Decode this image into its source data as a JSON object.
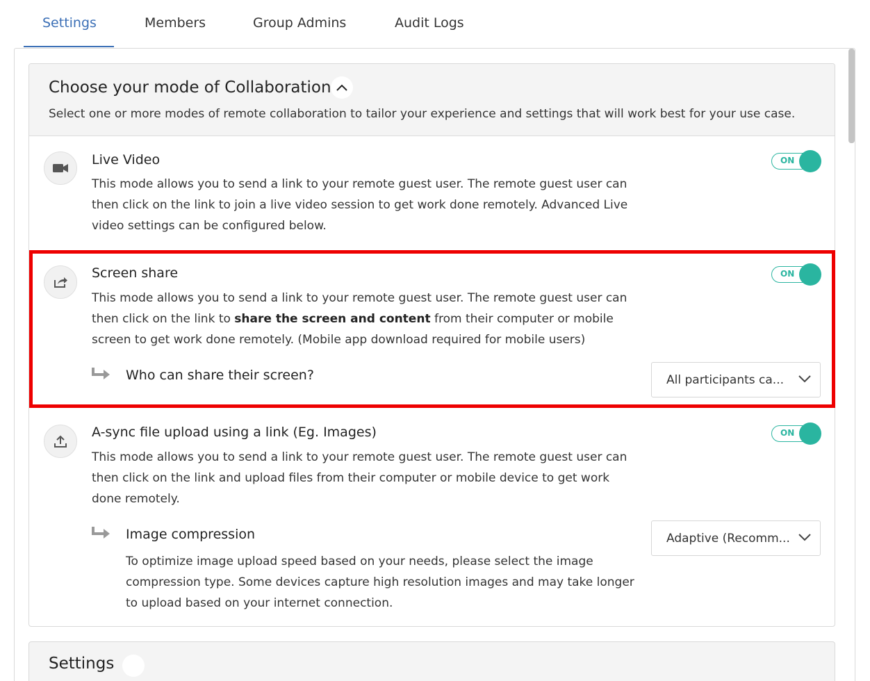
{
  "tabs": [
    {
      "label": "Settings",
      "active": true
    },
    {
      "label": "Members",
      "active": false
    },
    {
      "label": "Group Admins",
      "active": false
    },
    {
      "label": "Audit Logs",
      "active": false
    }
  ],
  "collaboration": {
    "title": "Choose your mode of Collaboration",
    "description": "Select one or more modes of remote collaboration to tailor your experience and settings that will work best for your use case.",
    "modes": [
      {
        "title": "Live Video",
        "icon": "video-camera-icon",
        "description": "This mode allows you to send a link to your remote guest user. The remote guest user can then click on the link to join a live video session to get work done remotely. Advanced Live video settings can be configured below.",
        "toggle": "ON"
      },
      {
        "title": "Screen share",
        "icon": "share-icon",
        "description_before": "This mode allows you to send a link to your remote guest user. The remote guest user can then click on the link to ",
        "description_bold": "share the screen and content",
        "description_after": " from their computer or mobile screen to get work done remotely. (Mobile app download required for mobile users)",
        "toggle": "ON",
        "sub_setting": {
          "label": "Who can share their screen?",
          "selected": "All participants ca..."
        }
      },
      {
        "title": "A-sync file upload using a link (Eg. Images)",
        "icon": "upload-icon",
        "description": "This mode allows you to send a link to your remote guest user. The remote guest user can then click on the link and upload files from their computer or mobile device to get work done remotely.",
        "toggle": "ON",
        "sub_setting": {
          "label": "Image compression",
          "description": "To optimize image upload speed based on your needs, please select the image compression type. Some devices capture high resolution images and may take longer to upload based on your internet connection.",
          "selected": "Adaptive (Recomm..."
        }
      }
    ]
  },
  "settings_panel": {
    "title": "Settings"
  },
  "colors": {
    "accent": "#3b6fb6",
    "toggle": "#2ab5a0",
    "highlight": "#ee0000"
  }
}
